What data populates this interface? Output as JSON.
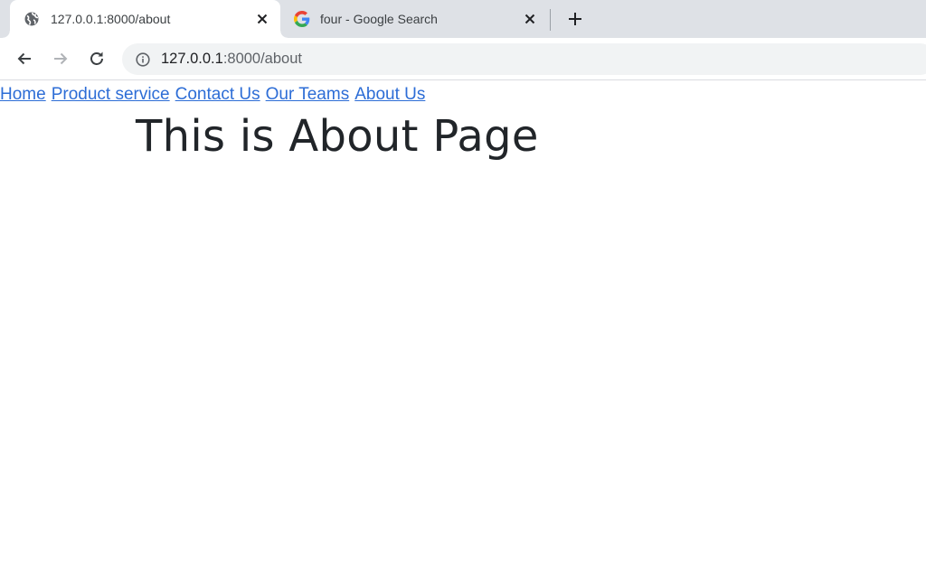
{
  "browser": {
    "tabs": [
      {
        "title": "127.0.0.1:8000/about",
        "favicon": "globe-icon",
        "active": true
      },
      {
        "title": "four - Google Search",
        "favicon": "google-g-icon",
        "active": false
      }
    ],
    "address_bar": {
      "host": "127.0.0.1",
      "path": ":8000/about"
    }
  },
  "page": {
    "nav": {
      "home": "Home",
      "product_service": "Product service",
      "contact_us": "Contact Us",
      "our_teams": "Our Teams",
      "about_us": "About Us"
    },
    "heading": "This is About Page"
  },
  "colors": {
    "link": "#2d6dd6",
    "heading": "#212529",
    "tabstrip": "#dee1e6",
    "omnibox": "#f1f3f4"
  }
}
